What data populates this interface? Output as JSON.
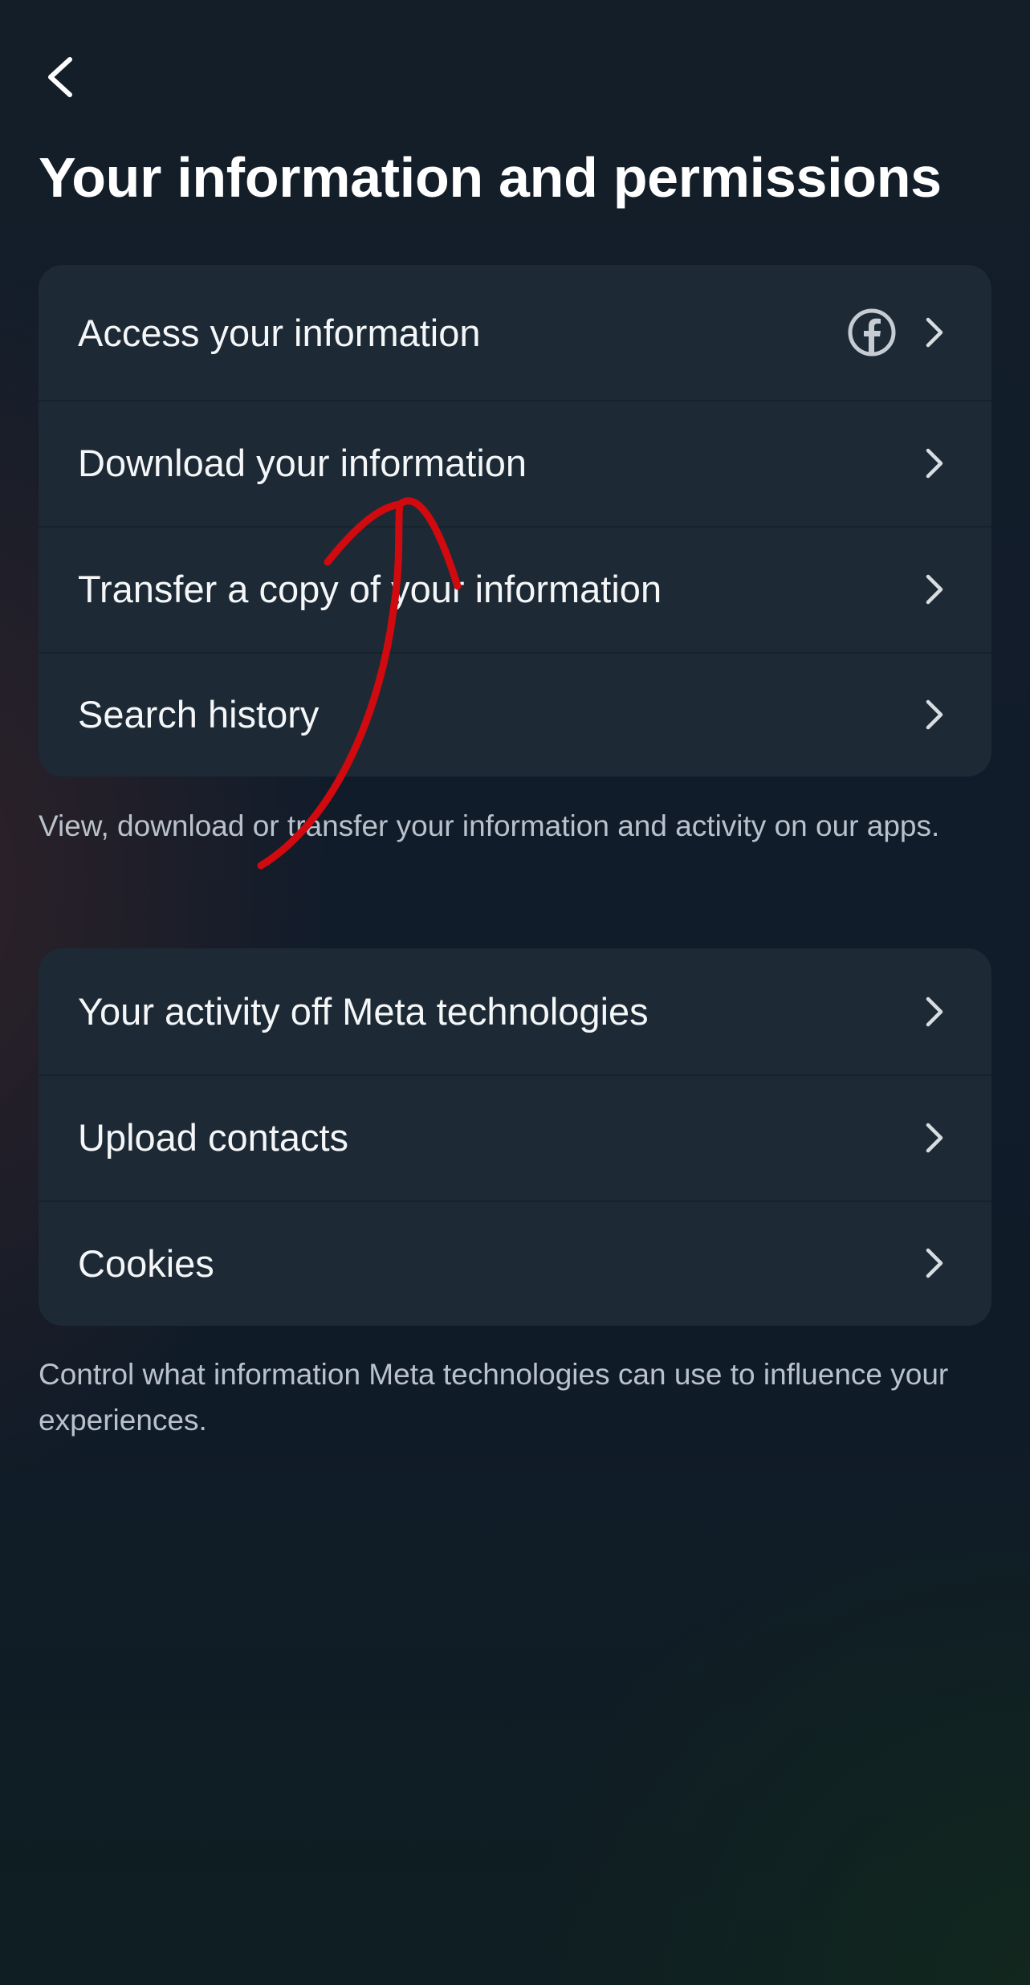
{
  "header": {
    "back_icon": "chevron-left-icon",
    "title": "Your information and permissions"
  },
  "groups": [
    {
      "items": [
        {
          "label": "Access your information",
          "badge_icon": "facebook-icon",
          "arrow_icon": "chevron-right-icon"
        },
        {
          "label": "Download your information",
          "arrow_icon": "chevron-right-icon"
        },
        {
          "label": "Transfer a copy of your information",
          "arrow_icon": "chevron-right-icon"
        },
        {
          "label": "Search history",
          "arrow_icon": "chevron-right-icon"
        }
      ],
      "caption": "View, download or transfer your information and activity on our apps."
    },
    {
      "items": [
        {
          "label": "Your activity off Meta technologies",
          "arrow_icon": "chevron-right-icon"
        },
        {
          "label": "Upload contacts",
          "arrow_icon": "chevron-right-icon"
        },
        {
          "label": "Cookies",
          "arrow_icon": "chevron-right-icon"
        }
      ],
      "caption": "Control what information Meta technologies can use to influence your experiences."
    }
  ],
  "colors": {
    "background": "#121d2a",
    "card": "#1d2a35",
    "text_primary": "#f4f6f8",
    "text_secondary": "#b9c2cb",
    "annotation_stroke": "#d10a0f"
  }
}
